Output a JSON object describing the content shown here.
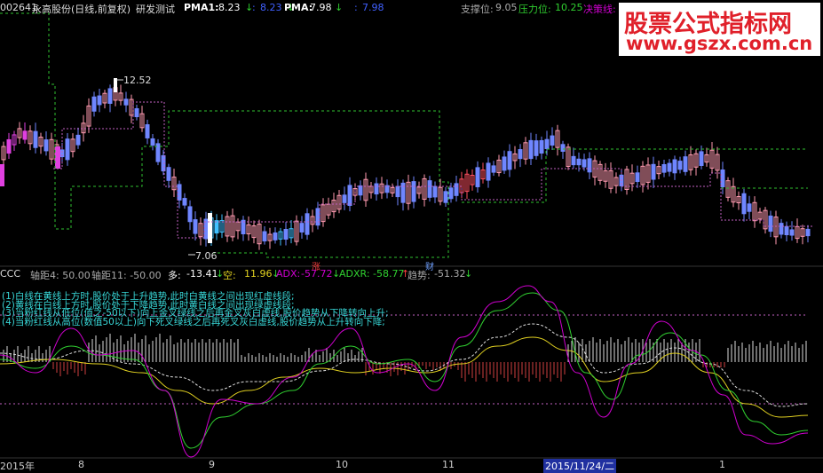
{
  "header": {
    "code": "002641",
    "name": "永高股份(日线,前复权)",
    "indicator": "研发测试",
    "pma1_label": "PMA1:",
    "pma1_value": "8.23",
    "pma1_arrow": "↓",
    "pma1b_label": ":",
    "pma1b_value": "8.23",
    "pma1b_arrow": "↓",
    "pma_label": "PMA:",
    "pma_value": "7.98",
    "pma_arrow": "↓",
    "pmab_label": ":",
    "pmab_value": "7.98",
    "support_label": "支撑位:",
    "support_value": "9.05",
    "pressure_label": "压力位:",
    "pressure_value": "10.25",
    "decision_label": "决策线:"
  },
  "price_labels": {
    "high": "12.52",
    "low": "7.06"
  },
  "markers": {
    "up": "涨",
    "down": "财"
  },
  "indicator_bar": {
    "name": "CCC",
    "axis4": "轴距4: 50.00",
    "axis11": "轴距11: -50.00",
    "duo_label": "多:",
    "duo_value": "-13.41",
    "duo_arrow": "↓",
    "kong_label": "空:",
    "kong_value": "11.96",
    "kong_arrow": "↓",
    "adx_label": "ADX:",
    "adx_value": "-57.72",
    "adx_arrow": "↓",
    "adxr_label": "ADXR:",
    "adxr_value": "-58.77",
    "adxr_arrow": "↑",
    "trend_label": "趋势:",
    "trend_value": "-51.32",
    "trend_arrow": "↓"
  },
  "notes": [
    "(1)白线在黄线上方时,股价处于上升趋势,此时白黄线之间出现红虚线段;",
    "(2)黄线在白线上方时,股价处于下降趋势,此时黄白线之间出现绿虚线段;",
    "(3)当粉红线从低位(值之-50以下)向上金叉绿线之后再金叉灰白虚线,股价趋势从下降转向上升;",
    "(4)当粉红线从高位(数值50以上)向下死叉绿线之后再死叉灰白虚线,股价趋势从上升转向下降;"
  ],
  "dates": [
    "2015年",
    "8",
    "9",
    "10",
    "11",
    "2015/11/24/二",
    "1"
  ],
  "logo": {
    "line1": "股票公式指标网",
    "line2": "www.gszx.com.cn"
  },
  "colors": {
    "bg": "#000000",
    "cyan": "#38d8d8",
    "magenta": "#d000d0",
    "yellow": "#e0d020",
    "green": "#30d030",
    "red": "#ff4040",
    "pink": "#ff9ab0",
    "blue": "#4060ff",
    "brand_red": "#e0202a"
  }
}
